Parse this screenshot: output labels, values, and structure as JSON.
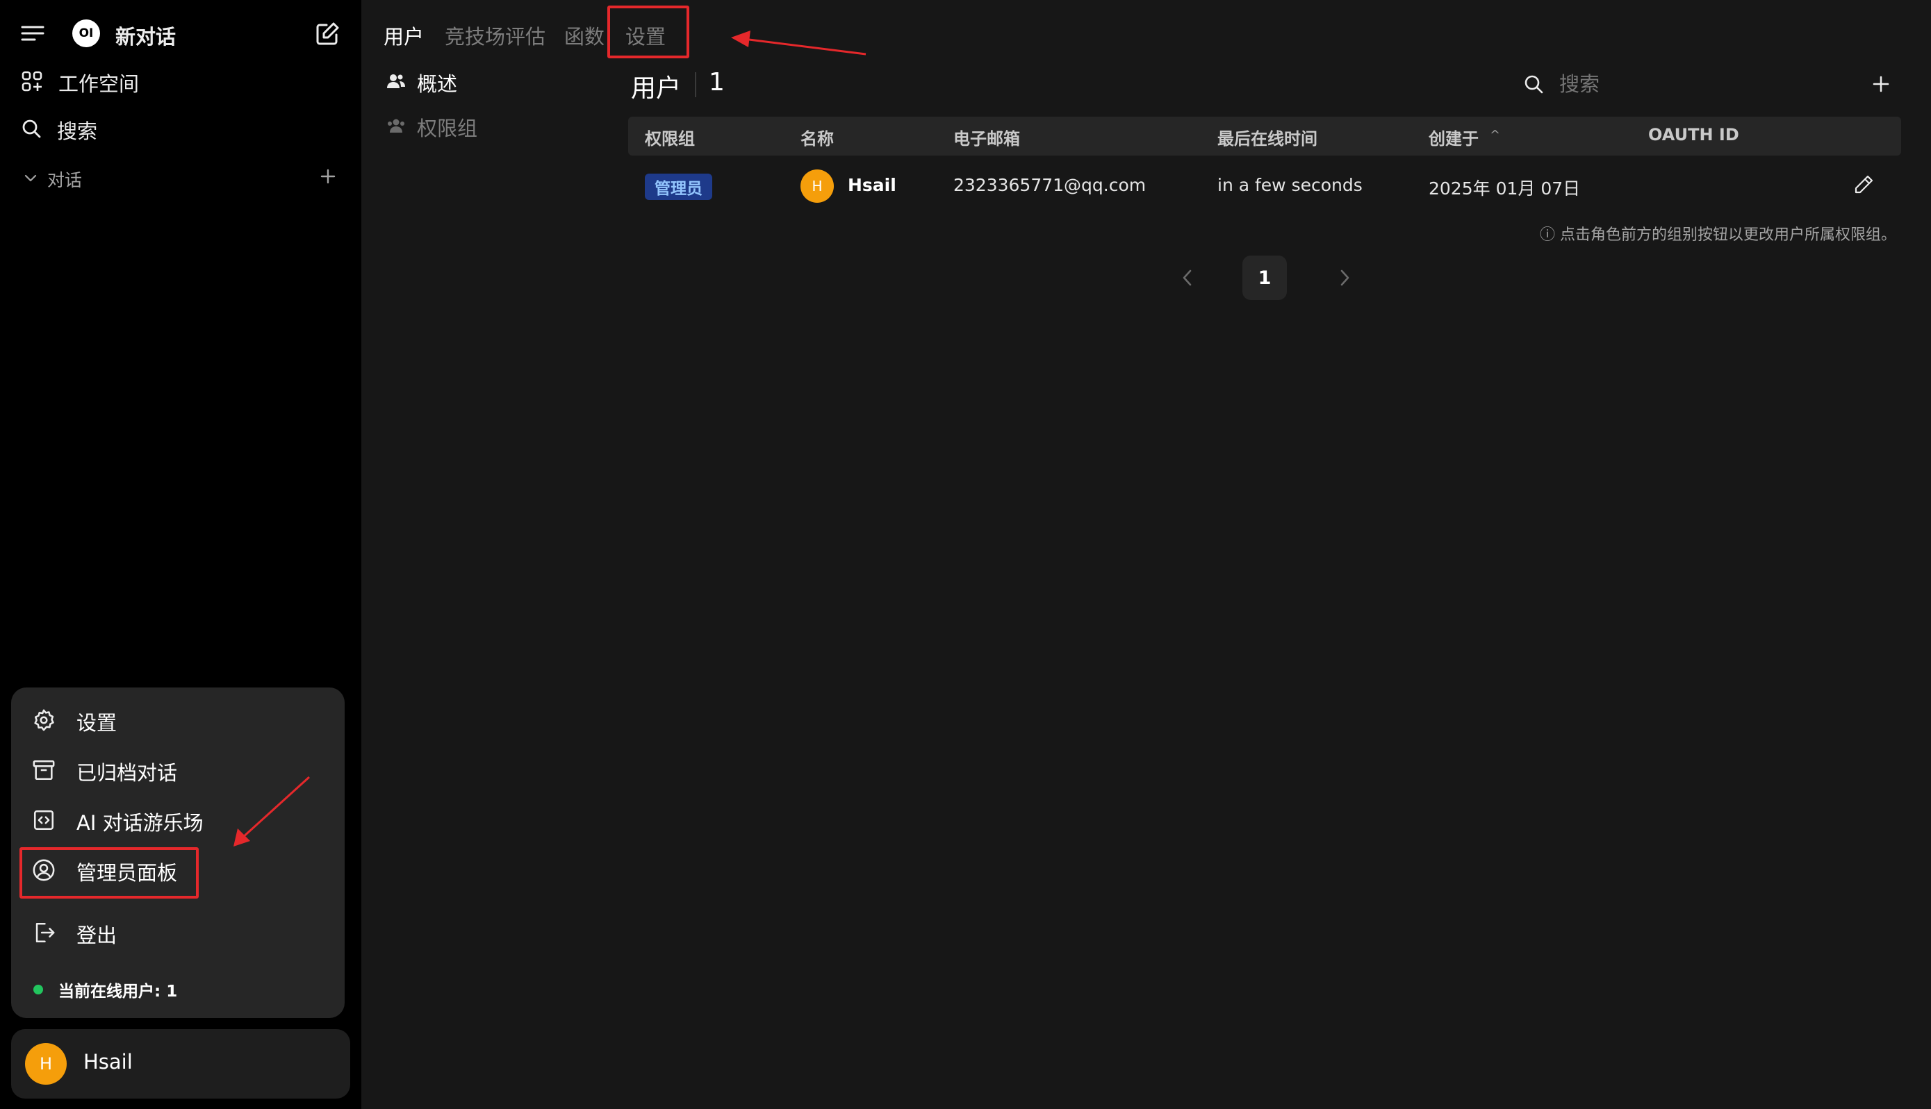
{
  "sidebar": {
    "new_chat": "新对话",
    "logo_text": "OI",
    "workspace": "工作空间",
    "search": "搜索",
    "conversations": "对话",
    "menu": {
      "settings": "设置",
      "archived": "已归档对话",
      "playground": "AI 对话游乐场",
      "admin_panel": "管理员面板",
      "logout": "登出",
      "online_users": "当前在线用户: 1"
    },
    "user": {
      "initial": "H",
      "name": "Hsail"
    }
  },
  "tabs": [
    "用户",
    "竞技场评估",
    "函数",
    "设置"
  ],
  "subnav": {
    "overview": "概述",
    "groups": "权限组"
  },
  "users": {
    "title": "用户",
    "count": "1",
    "search_placeholder": "搜索",
    "columns": [
      "权限组",
      "名称",
      "电子邮箱",
      "最后在线时间",
      "创建于",
      "OAUTH ID"
    ],
    "sort_indicator": "^",
    "rows": [
      {
        "role": "管理员",
        "initial": "H",
        "name": "Hsail",
        "email": "2323365771@qq.com",
        "last_active": "in a few seconds",
        "created": "2025年 01月 07日",
        "oauth": ""
      }
    ],
    "hint": "ⓘ 点击角色前方的组别按钮以更改用户所属权限组。",
    "page": "1"
  },
  "colors": {
    "accent_red": "#e5282b",
    "avatar": "#f59e0b",
    "online": "#22c55e",
    "role_badge_bg": "#1e3a8a",
    "role_badge_text": "#93c5fd"
  },
  "icons": [
    "sidebar-toggle-icon",
    "new-chat-icon",
    "workspace-icon",
    "search-icon",
    "chevron-down-icon",
    "plus-icon",
    "gear-icon",
    "archive-icon",
    "code-icon",
    "user-circle-icon",
    "logout-icon",
    "users-icon",
    "pencil-icon",
    "chevron-left-icon",
    "chevron-right-icon"
  ]
}
